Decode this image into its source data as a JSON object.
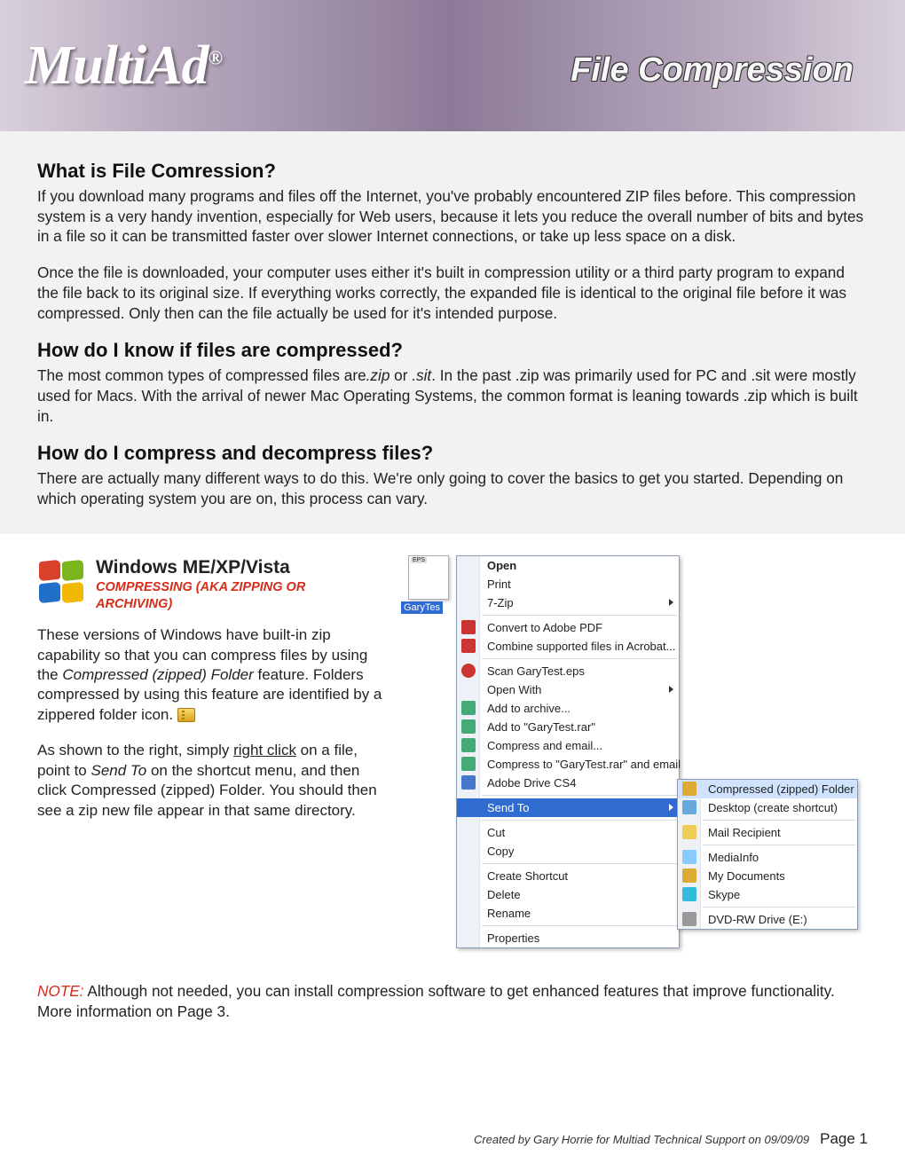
{
  "banner": {
    "logo_text": "MultiAd",
    "logo_mark": "®",
    "title": "File Compression"
  },
  "sections": {
    "s1_h": "What is File Comression?",
    "s1_p1": "If you download many programs and files off the Internet, you've probably encountered ZIP files before. This compression system is a very handy invention, especially for Web users, because it lets you reduce the overall number of bits and bytes in a file so it can be transmitted faster over slower Internet connections, or take up less space on a disk.",
    "s1_p2": "Once the file is downloaded, your computer uses either it's built in compression utility or a third party program to expand the file back to its original size. If everything works correctly, the expanded file is identical to the original file before it was compressed. Only then can the file actually be used for it's intended purpose.",
    "s2_h": "How do I know if files are compressed?",
    "s2_p1a": "The most common types of compressed files are",
    "s2_p1b": ".zip",
    "s2_p1c": " or ",
    "s2_p1d": ".sit",
    "s2_p1e": ". In the past .zip was primarily used for PC and .sit were mostly used for Macs. With the arrival of newer Mac Operating Systems, the common format is leaning towards .zip which is built in.",
    "s3_h": "How do I compress and decompress files?",
    "s3_p1": "There are actually many different ways to do this. We're only going to cover the basics to get you started. Depending on which operating system you are on, this process can vary."
  },
  "windows": {
    "title": "Windows ME/XP/Vista",
    "subtitle": "COMPRESSING (AKA ZIPPING OR ARCHIVING)",
    "p1a": "These versions of Windows have built-in zip capability so that you can compress files by using the ",
    "p1b": "Compressed (zipped) Folder",
    "p1c": " feature. Folders compressed by using this feature are identified by a zippered folder icon. ",
    "p2a": "As shown to the right, simply ",
    "p2b": "right click",
    "p2c": " on a file, point to ",
    "p2d": "Send To",
    "p2e": " on the shortcut menu, and then click Compressed (zipped) Folder. You should then see a zip new file appear in that same directory."
  },
  "file_label": "GaryTes",
  "menu1": [
    {
      "label": "Open",
      "bold": true
    },
    {
      "label": "Print"
    },
    {
      "label": "7-Zip",
      "arrow": true
    },
    {
      "sep": true
    },
    {
      "label": "Convert to Adobe PDF",
      "icon": "#c33"
    },
    {
      "label": "Combine supported files in Acrobat...",
      "icon": "#c33"
    },
    {
      "sep": true
    },
    {
      "label": "Scan GaryTest.eps",
      "icon": "#c33",
      "round": true
    },
    {
      "label": "Open With",
      "arrow": true
    },
    {
      "label": "Add to archive...",
      "icon": "#4a7"
    },
    {
      "label": "Add to \"GaryTest.rar\"",
      "icon": "#4a7"
    },
    {
      "label": "Compress and email...",
      "icon": "#4a7"
    },
    {
      "label": "Compress to \"GaryTest.rar\" and email",
      "icon": "#4a7"
    },
    {
      "label": "Adobe Drive CS4",
      "icon": "#47c"
    },
    {
      "sep": true
    },
    {
      "label": "Send To",
      "arrow": true,
      "highlight": true
    },
    {
      "sep": true
    },
    {
      "label": "Cut"
    },
    {
      "label": "Copy"
    },
    {
      "sep": true
    },
    {
      "label": "Create Shortcut"
    },
    {
      "label": "Delete"
    },
    {
      "label": "Rename"
    },
    {
      "sep": true
    },
    {
      "label": "Properties"
    }
  ],
  "menu2": [
    {
      "label": "Compressed (zipped) Folder",
      "icon": "#da3",
      "highlight": true
    },
    {
      "label": "Desktop (create shortcut)",
      "icon": "#6ad"
    },
    {
      "sep": true
    },
    {
      "label": "Mail Recipient",
      "icon": "#ec5"
    },
    {
      "sep": true
    },
    {
      "label": "MediaInfo",
      "icon": "#8cf"
    },
    {
      "label": "My Documents",
      "icon": "#da3"
    },
    {
      "label": "Skype",
      "icon": "#3bd"
    },
    {
      "sep": true
    },
    {
      "label": "DVD-RW Drive (E:)",
      "icon": "#999"
    }
  ],
  "note": {
    "label": "NOTE:",
    "text": " Although not needed, you can install compression software to get enhanced features that improve functionality. More information on Page 3."
  },
  "footer": {
    "credit": "Created by Gary Horrie for Multiad Technical Support on 09/09/09",
    "page": "Page 1"
  }
}
